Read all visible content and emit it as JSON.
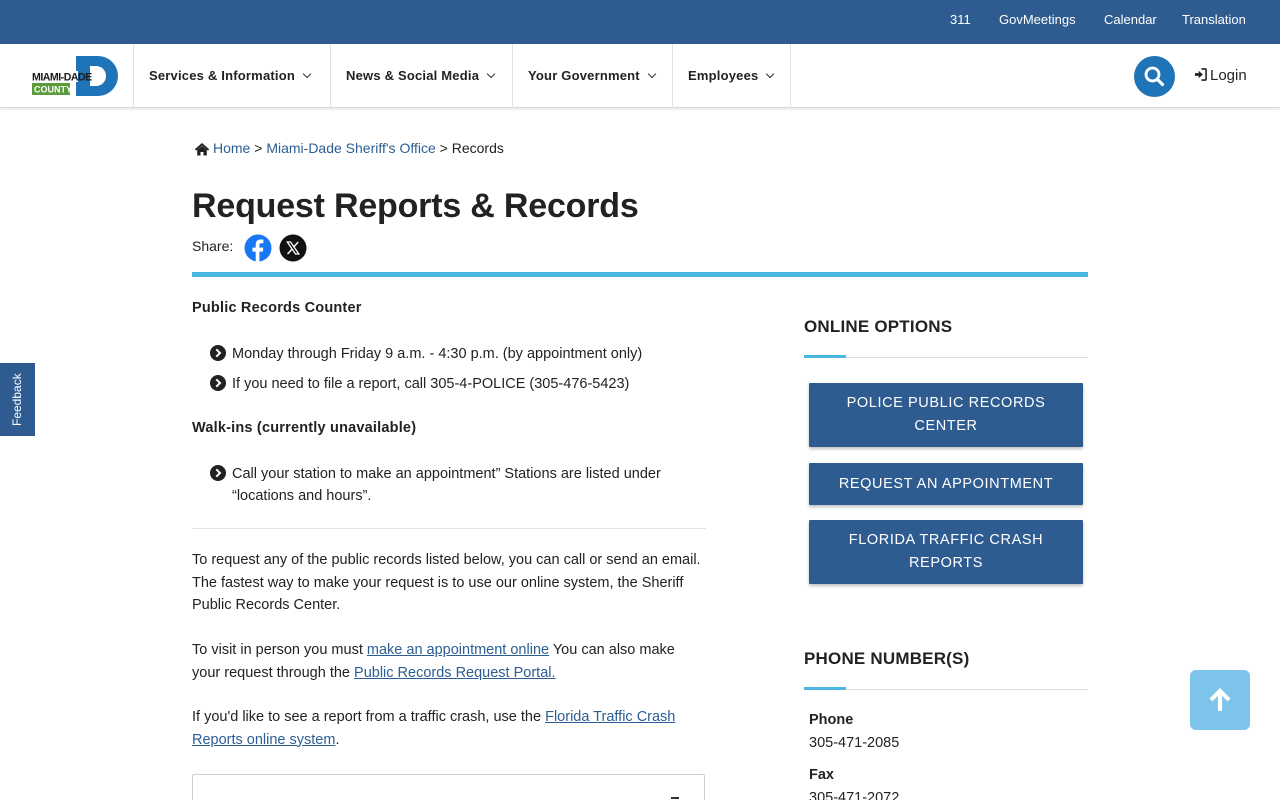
{
  "utility_links": [
    "311",
    "GovMeetings",
    "Calendar",
    "Translation"
  ],
  "logo": {
    "line1": "MIAMI-DADE",
    "line2": "COUNTY"
  },
  "nav": {
    "items": [
      "Services & Information",
      "News & Social Media",
      "Your Government",
      "Employees"
    ],
    "login": "Login"
  },
  "breadcrumb": {
    "home": "Home",
    "sep": ">",
    "parent": "Miami-Dade Sheriff's Office",
    "current": "Records"
  },
  "page": {
    "title": "Request Reports & Records",
    "share_label": "Share:"
  },
  "records_counter": {
    "heading": "Public Records Counter",
    "items": [
      "Monday through Friday 9 a.m. - 4:30 p.m. (by appointment only)",
      "If you need to file a report, call 305-4-POLICE (305-476-5423)"
    ]
  },
  "walkins": {
    "heading": "Walk-ins (currently unavailable)",
    "items": [
      "Call your station to make an appointment” Stations are listed under “locations and hours”."
    ]
  },
  "body": {
    "p1": "To request any of the public records listed below, you can call or send an email. The fastest way to make your request is to use our online system, the Sheriff Public Records Center.",
    "p2_prefix": "To visit in person you must ",
    "p2_link1": "make an appointment online",
    "p2_middle": " You can also make your request through the ",
    "p2_link2": "Public Records Request Portal.",
    "p3_prefix": "If you'd like to see a report from a traffic crash, use the ",
    "p3_link": "Florida Traffic Crash Reports online system",
    "p3_suffix": "."
  },
  "online_options": {
    "heading": "ONLINE OPTIONS",
    "buttons": [
      "POLICE PUBLIC RECORDS CENTER",
      "REQUEST AN APPOINTMENT",
      "FLORIDA TRAFFIC CRASH REPORTS"
    ]
  },
  "phone_numbers": {
    "heading": "PHONE NUMBER(S)",
    "entries": [
      {
        "label": "Phone",
        "value": "305-471-2085"
      },
      {
        "label": "Fax",
        "value": "305-471-2072"
      }
    ]
  },
  "feedback": "Feedback",
  "icons": {
    "search": "search-icon",
    "login": "sign-in-icon",
    "home": "home-icon",
    "facebook": "facebook-icon",
    "x": "x-icon",
    "bullet": "chevron-circle-right-icon",
    "back_to_top": "arrow-up-icon"
  },
  "colors": {
    "header_blue": "#2e5c91",
    "accent_cyan": "#4ab7e2",
    "search_blue": "#1f73b7",
    "link": "#2c5e93",
    "logo_green": "#5a9b3a",
    "to_top": "#7cc4ea"
  }
}
